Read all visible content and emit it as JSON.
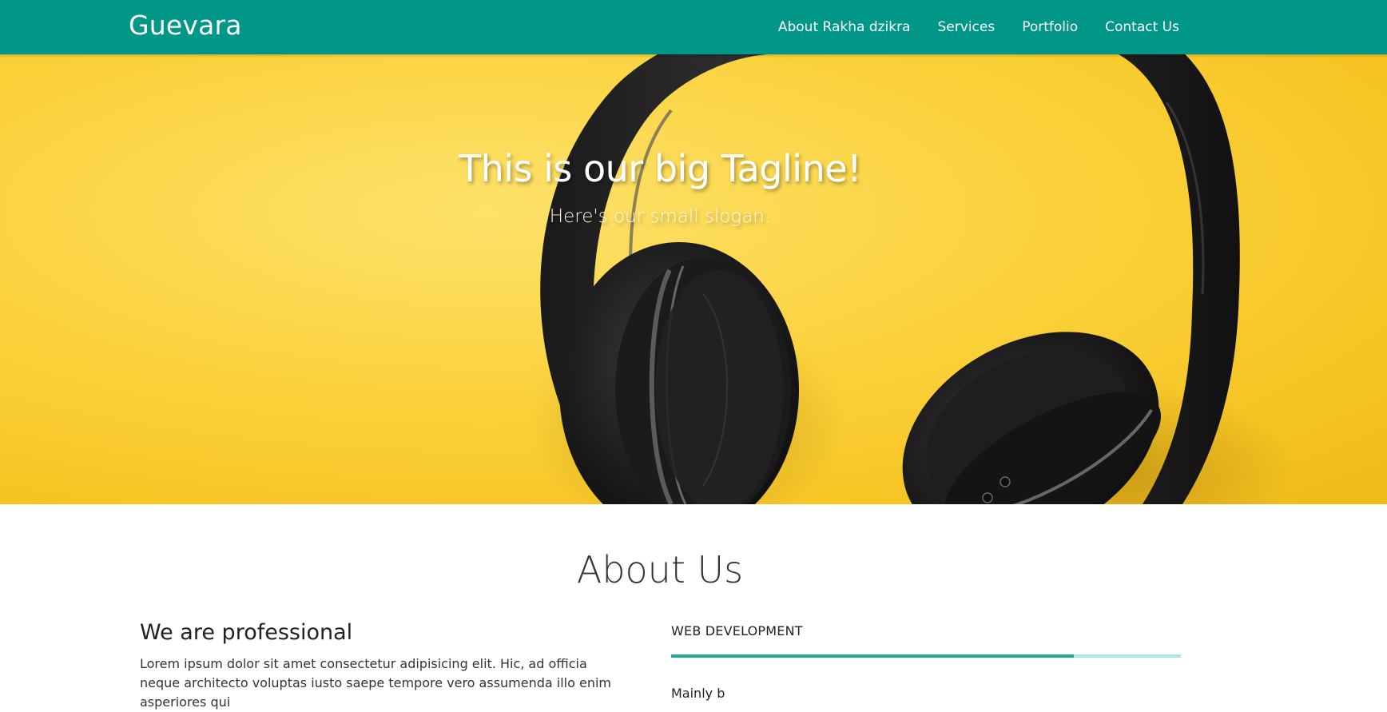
{
  "navbar": {
    "brand": "Guevara",
    "links": [
      {
        "label": "About Rakha dzikra"
      },
      {
        "label": "Services"
      },
      {
        "label": "Portfolio"
      },
      {
        "label": "Contact Us"
      }
    ],
    "background": "#009688"
  },
  "hero": {
    "tagline": "This is our big Tagline!",
    "slogan": "Here's our small slogan.",
    "background_color": "#fbd23c",
    "image_subject": "headphones-on-yellow"
  },
  "about": {
    "title": "About Us",
    "subtitle": "We are professional",
    "paragraph": "Lorem ipsum dolor sit amet consectetur adipisicing elit. Hic, ad officia neque architecto voluptas iusto saepe tempore vero assumenda illo enim asperiores qui",
    "skills": [
      {
        "label": "WEB DEVELOPMENT",
        "progress": 0.79
      },
      {
        "label": "Mainly b"
      }
    ],
    "accent": "#26a69a",
    "track_color": "#a7e6e1"
  }
}
